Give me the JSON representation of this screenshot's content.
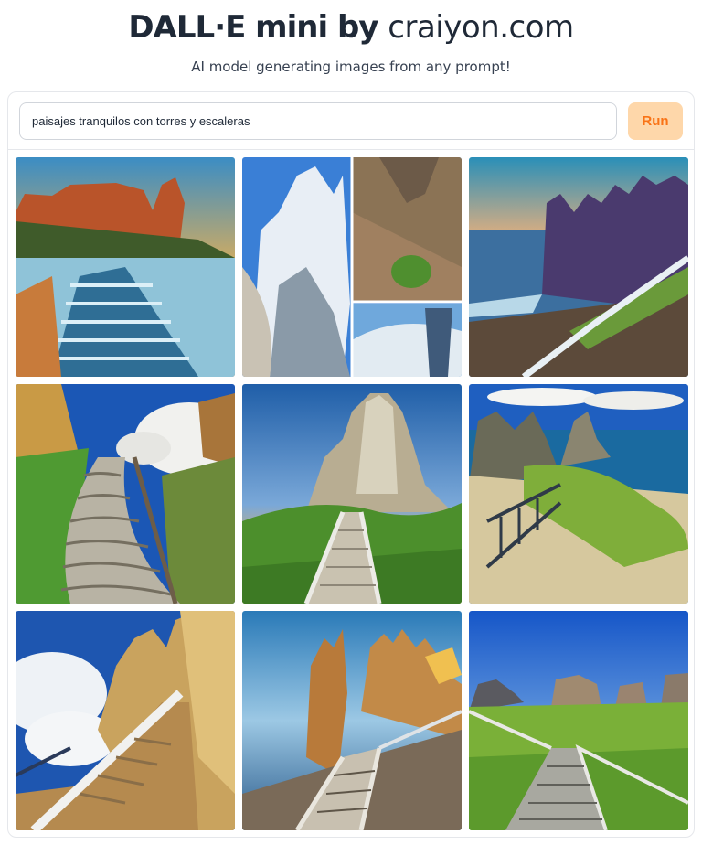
{
  "header": {
    "title_prefix": "DALL·E mini by ",
    "title_link": "craiyon.com",
    "subtitle": "AI model generating images from any prompt!"
  },
  "prompt": {
    "value": "paisajes tranquilos con torres y escaleras"
  },
  "run_button": {
    "label": "Run"
  },
  "colors": {
    "accent_bg": "#fed7aa",
    "accent_text": "#f97316",
    "border": "#e5e7eb"
  },
  "results": {
    "images": [
      "image-1",
      "image-2",
      "image-3",
      "image-4",
      "image-5",
      "image-6",
      "image-7",
      "image-8",
      "image-9"
    ]
  }
}
